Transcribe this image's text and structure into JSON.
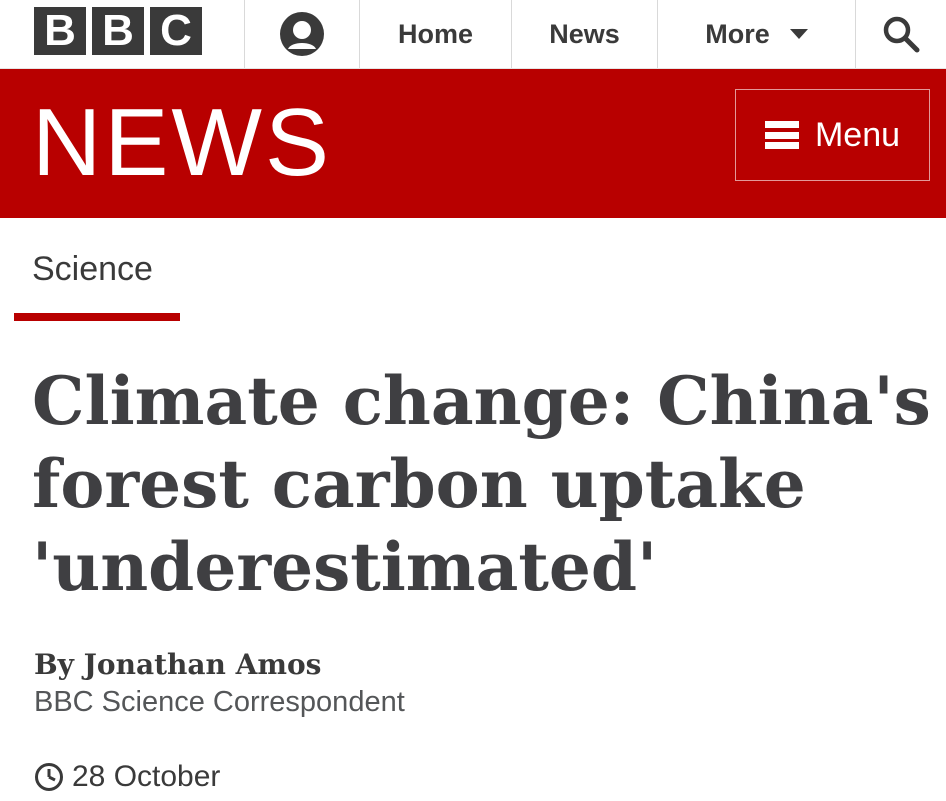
{
  "brand": {
    "letters": [
      "B",
      "B",
      "C"
    ],
    "block_color": "#3a3a3a"
  },
  "top_nav": {
    "account_icon": "user-silhouette-icon",
    "items": [
      {
        "label": "Home"
      },
      {
        "label": "News"
      },
      {
        "label": "More"
      }
    ],
    "search_icon": "search-icon"
  },
  "masthead": {
    "title": "NEWS",
    "menu_label": "Menu",
    "menu_icon": "hamburger-icon",
    "background_color": "#b80000"
  },
  "section": {
    "label": "Science",
    "accent_color": "#b80000"
  },
  "article": {
    "headline": "Climate change: China's forest carbon uptake 'underestimated'",
    "byline": "By Jonathan Amos",
    "byline_role": "BBC Science Correspondent",
    "date": "28 October",
    "date_icon": "clock-icon"
  }
}
